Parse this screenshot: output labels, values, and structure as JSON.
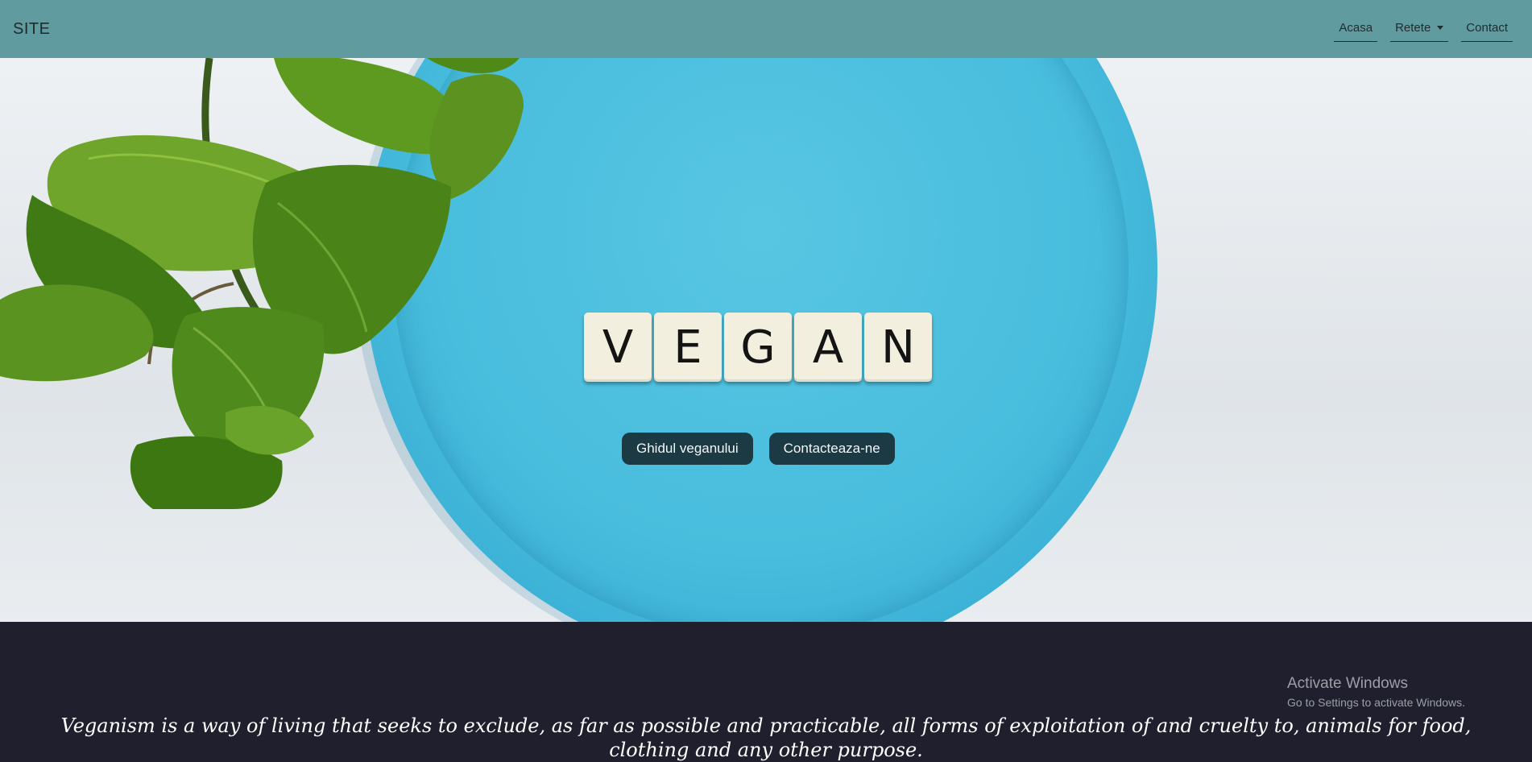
{
  "navbar": {
    "brand": "SITE",
    "links": [
      {
        "label": "Acasa"
      },
      {
        "label": "Retete",
        "dropdown": true
      },
      {
        "label": "Contact"
      }
    ],
    "background": "#609c9f"
  },
  "hero": {
    "tile_letters": [
      "V",
      "E",
      "G",
      "A",
      "N"
    ],
    "buttons": [
      {
        "label": "Ghidul veganului"
      },
      {
        "label": "Contacteaza-ne"
      }
    ],
    "button_color": "#1b3a44",
    "plate_color": "#49bddd"
  },
  "intro": {
    "quote": "Veganism is a way of living that seeks to exclude, as far as possible and practicable, all forms of exploitation of and cruelty to, animals for food, clothing and any other purpose."
  },
  "os_overlay": {
    "title": "Activate Windows",
    "subtitle": "Go to Settings to activate Windows."
  },
  "icons": [
    "caret-down-icon"
  ]
}
